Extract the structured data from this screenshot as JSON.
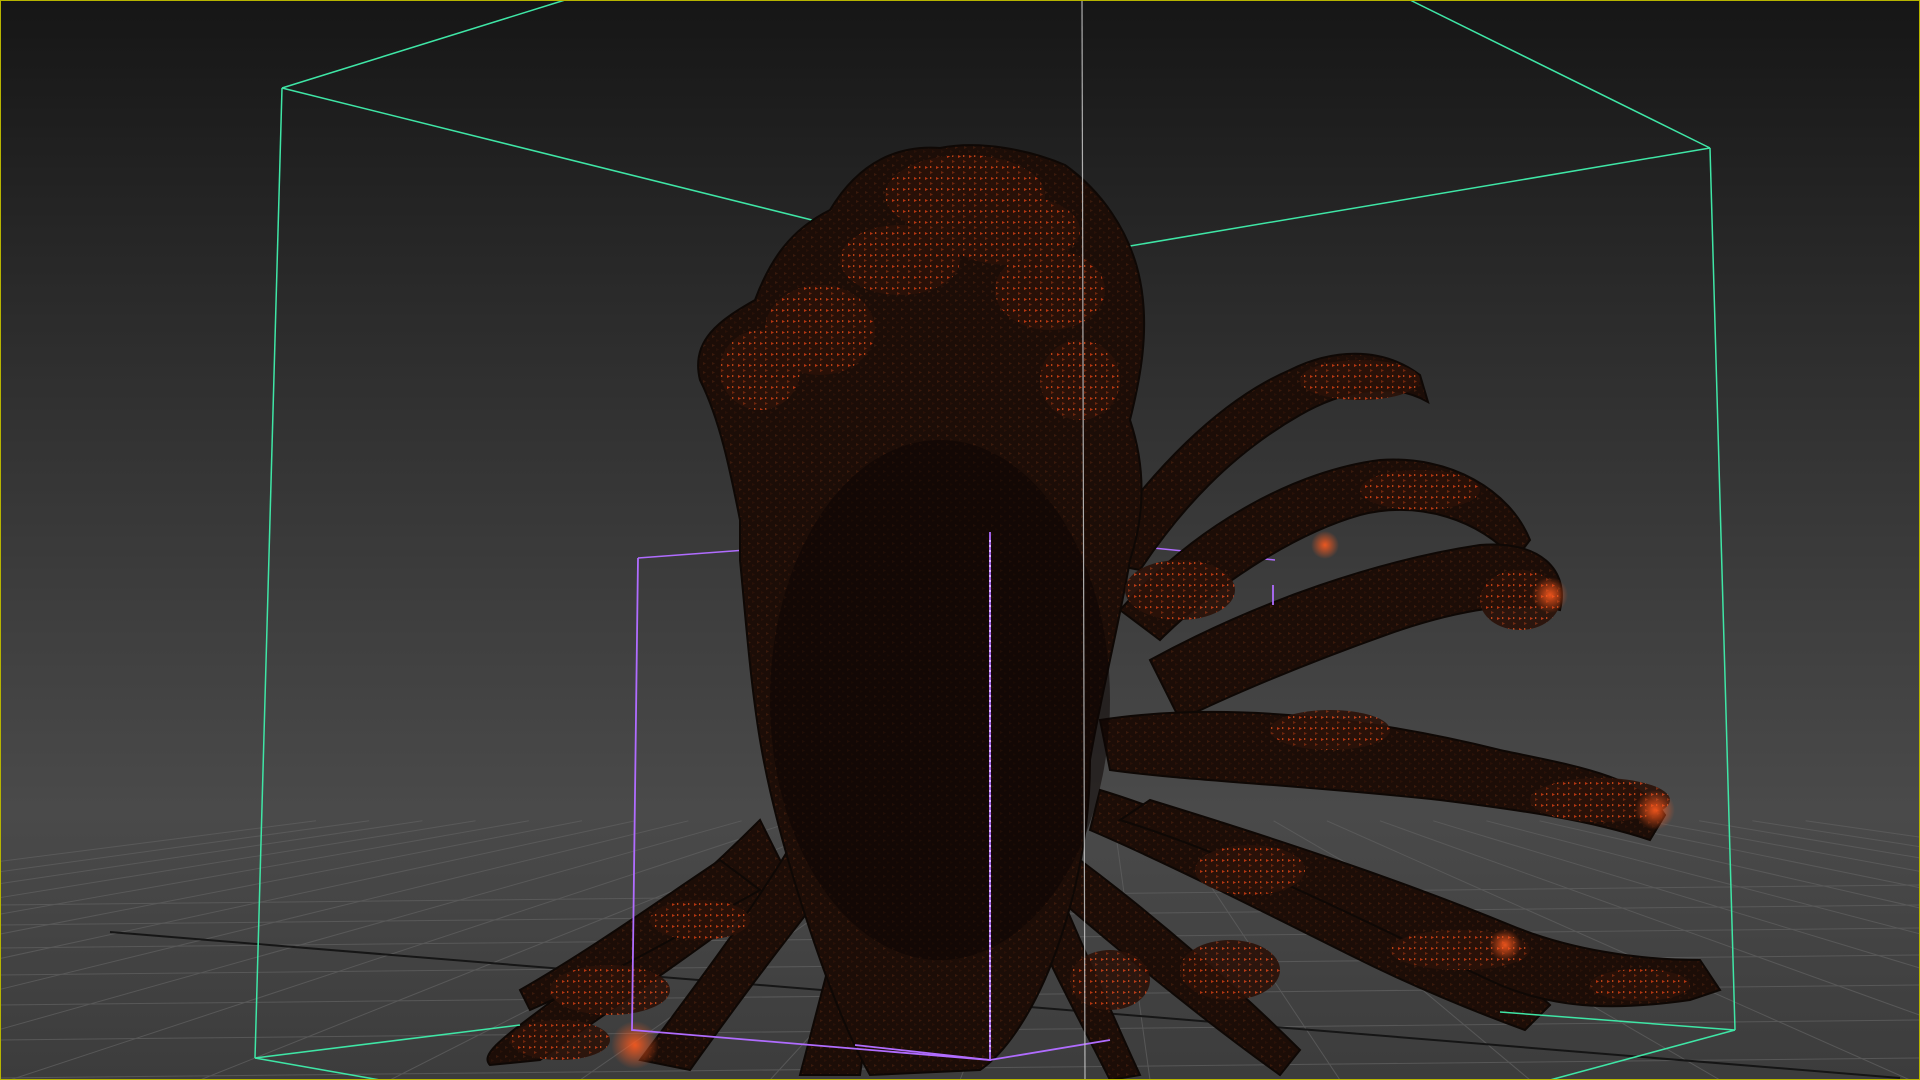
{
  "viewport": {
    "kind": "3d-viewport",
    "active_border_color": "#b6b400",
    "background_top": "#161616",
    "background_bottom": "#4a4a4a"
  },
  "scene": {
    "ground_grid": {
      "visible": true,
      "color": "#5e5e5e",
      "axis_color": "#0c0c0c"
    },
    "outer_bounding_box": {
      "color": "#3fe6a6"
    },
    "inner_bounding_box": {
      "color": "#b06cff"
    },
    "pivot_line_color": "#c9c9c9",
    "particle_volume": {
      "shape": "tentacled-organic-form",
      "base_color": "#1a0d08",
      "highlight_color": "#ff4a14",
      "glyph": "triangle-points"
    }
  }
}
